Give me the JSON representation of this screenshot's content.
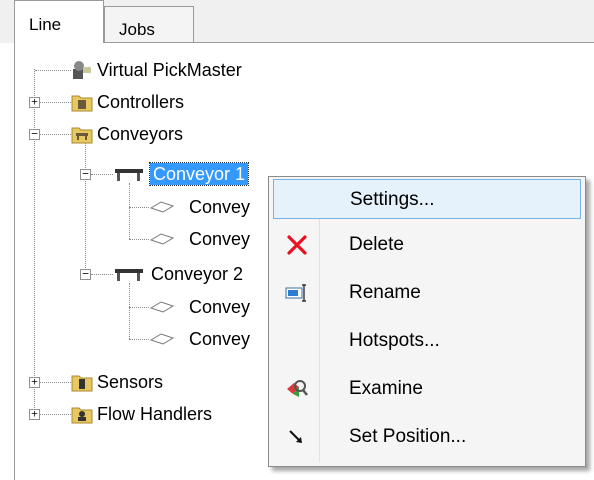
{
  "tabs": [
    {
      "label": "Line"
    },
    {
      "label": "Jobs"
    }
  ],
  "tree": {
    "virtual_pickmaster": "Virtual PickMaster",
    "controllers": "Controllers",
    "conveyors": "Conveyors",
    "conveyor1": "Conveyor 1",
    "conveyor1_child1": "Convey",
    "conveyor1_child2": "Convey",
    "conveyor2": "Conveyor 2",
    "conveyor2_child1": "Convey",
    "conveyor2_child2": "Convey",
    "sensors": "Sensors",
    "flow_handlers": "Flow Handlers"
  },
  "context_menu": {
    "items": [
      {
        "label": "Settings...",
        "icon": "none",
        "highlighted": true
      },
      {
        "label": "Delete",
        "icon": "delete-x-icon"
      },
      {
        "label": "Rename",
        "icon": "rename-icon"
      },
      {
        "label": "Hotspots...",
        "icon": "none"
      },
      {
        "label": "Examine",
        "icon": "examine-icon"
      },
      {
        "label": "Set Position...",
        "icon": "arrow-icon"
      }
    ]
  },
  "colors": {
    "selection": "#3399ff",
    "menu_hover": "#e5f1fb",
    "menu_hover_border": "#79b3e6",
    "delete_red": "#e81123"
  }
}
